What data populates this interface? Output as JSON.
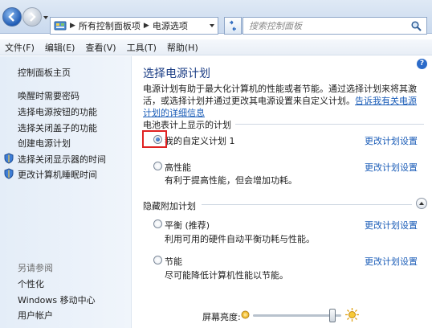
{
  "address": {
    "breadcrumbs": [
      "所有控制面板项",
      "电源选项"
    ],
    "search_placeholder": "搜索控制面板"
  },
  "menu": [
    "文件(F)",
    "编辑(E)",
    "查看(V)",
    "工具(T)",
    "帮助(H)"
  ],
  "sidebar": {
    "home": "控制面板主页",
    "links": [
      "唤醒时需要密码",
      "选择电源按钮的功能",
      "选择关闭盖子的功能",
      "创建电源计划",
      "选择关闭显示器的时间",
      "更改计算机睡眠时间"
    ],
    "see_also_label": "另请参阅",
    "see_also": [
      "个性化",
      "Windows 移动中心",
      "用户帐户"
    ]
  },
  "main": {
    "title": "选择电源计划",
    "desc_text": "电源计划有助于最大化计算机的性能或者节能。通过选择计划来将其激活，或选择计划并通过更改其电源设置来自定义计划。",
    "desc_link": "告诉我有关电源计划的详细信息",
    "section_shown": "电池表计上显示的计划",
    "section_hidden": "隐藏附加计划",
    "change_label": "更改计划设置",
    "plans": [
      {
        "name": "我的自定义计划 1",
        "desc": "",
        "selected": true
      },
      {
        "name": "高性能",
        "desc": "有利于提高性能，但会增加功耗。",
        "selected": false
      },
      {
        "name": "平衡 (推荐)",
        "desc": "利用可用的硬件自动平衡功耗与性能。",
        "selected": false
      },
      {
        "name": "节能",
        "desc": "尽可能降低计算机性能以节能。",
        "selected": false
      }
    ]
  },
  "bottom": {
    "brightness_label": "屏幕亮度:",
    "brightness_level": 0.9
  },
  "colors": {
    "link": "#1b5db8",
    "title": "#1a3c84",
    "highlight": "#e02222"
  }
}
